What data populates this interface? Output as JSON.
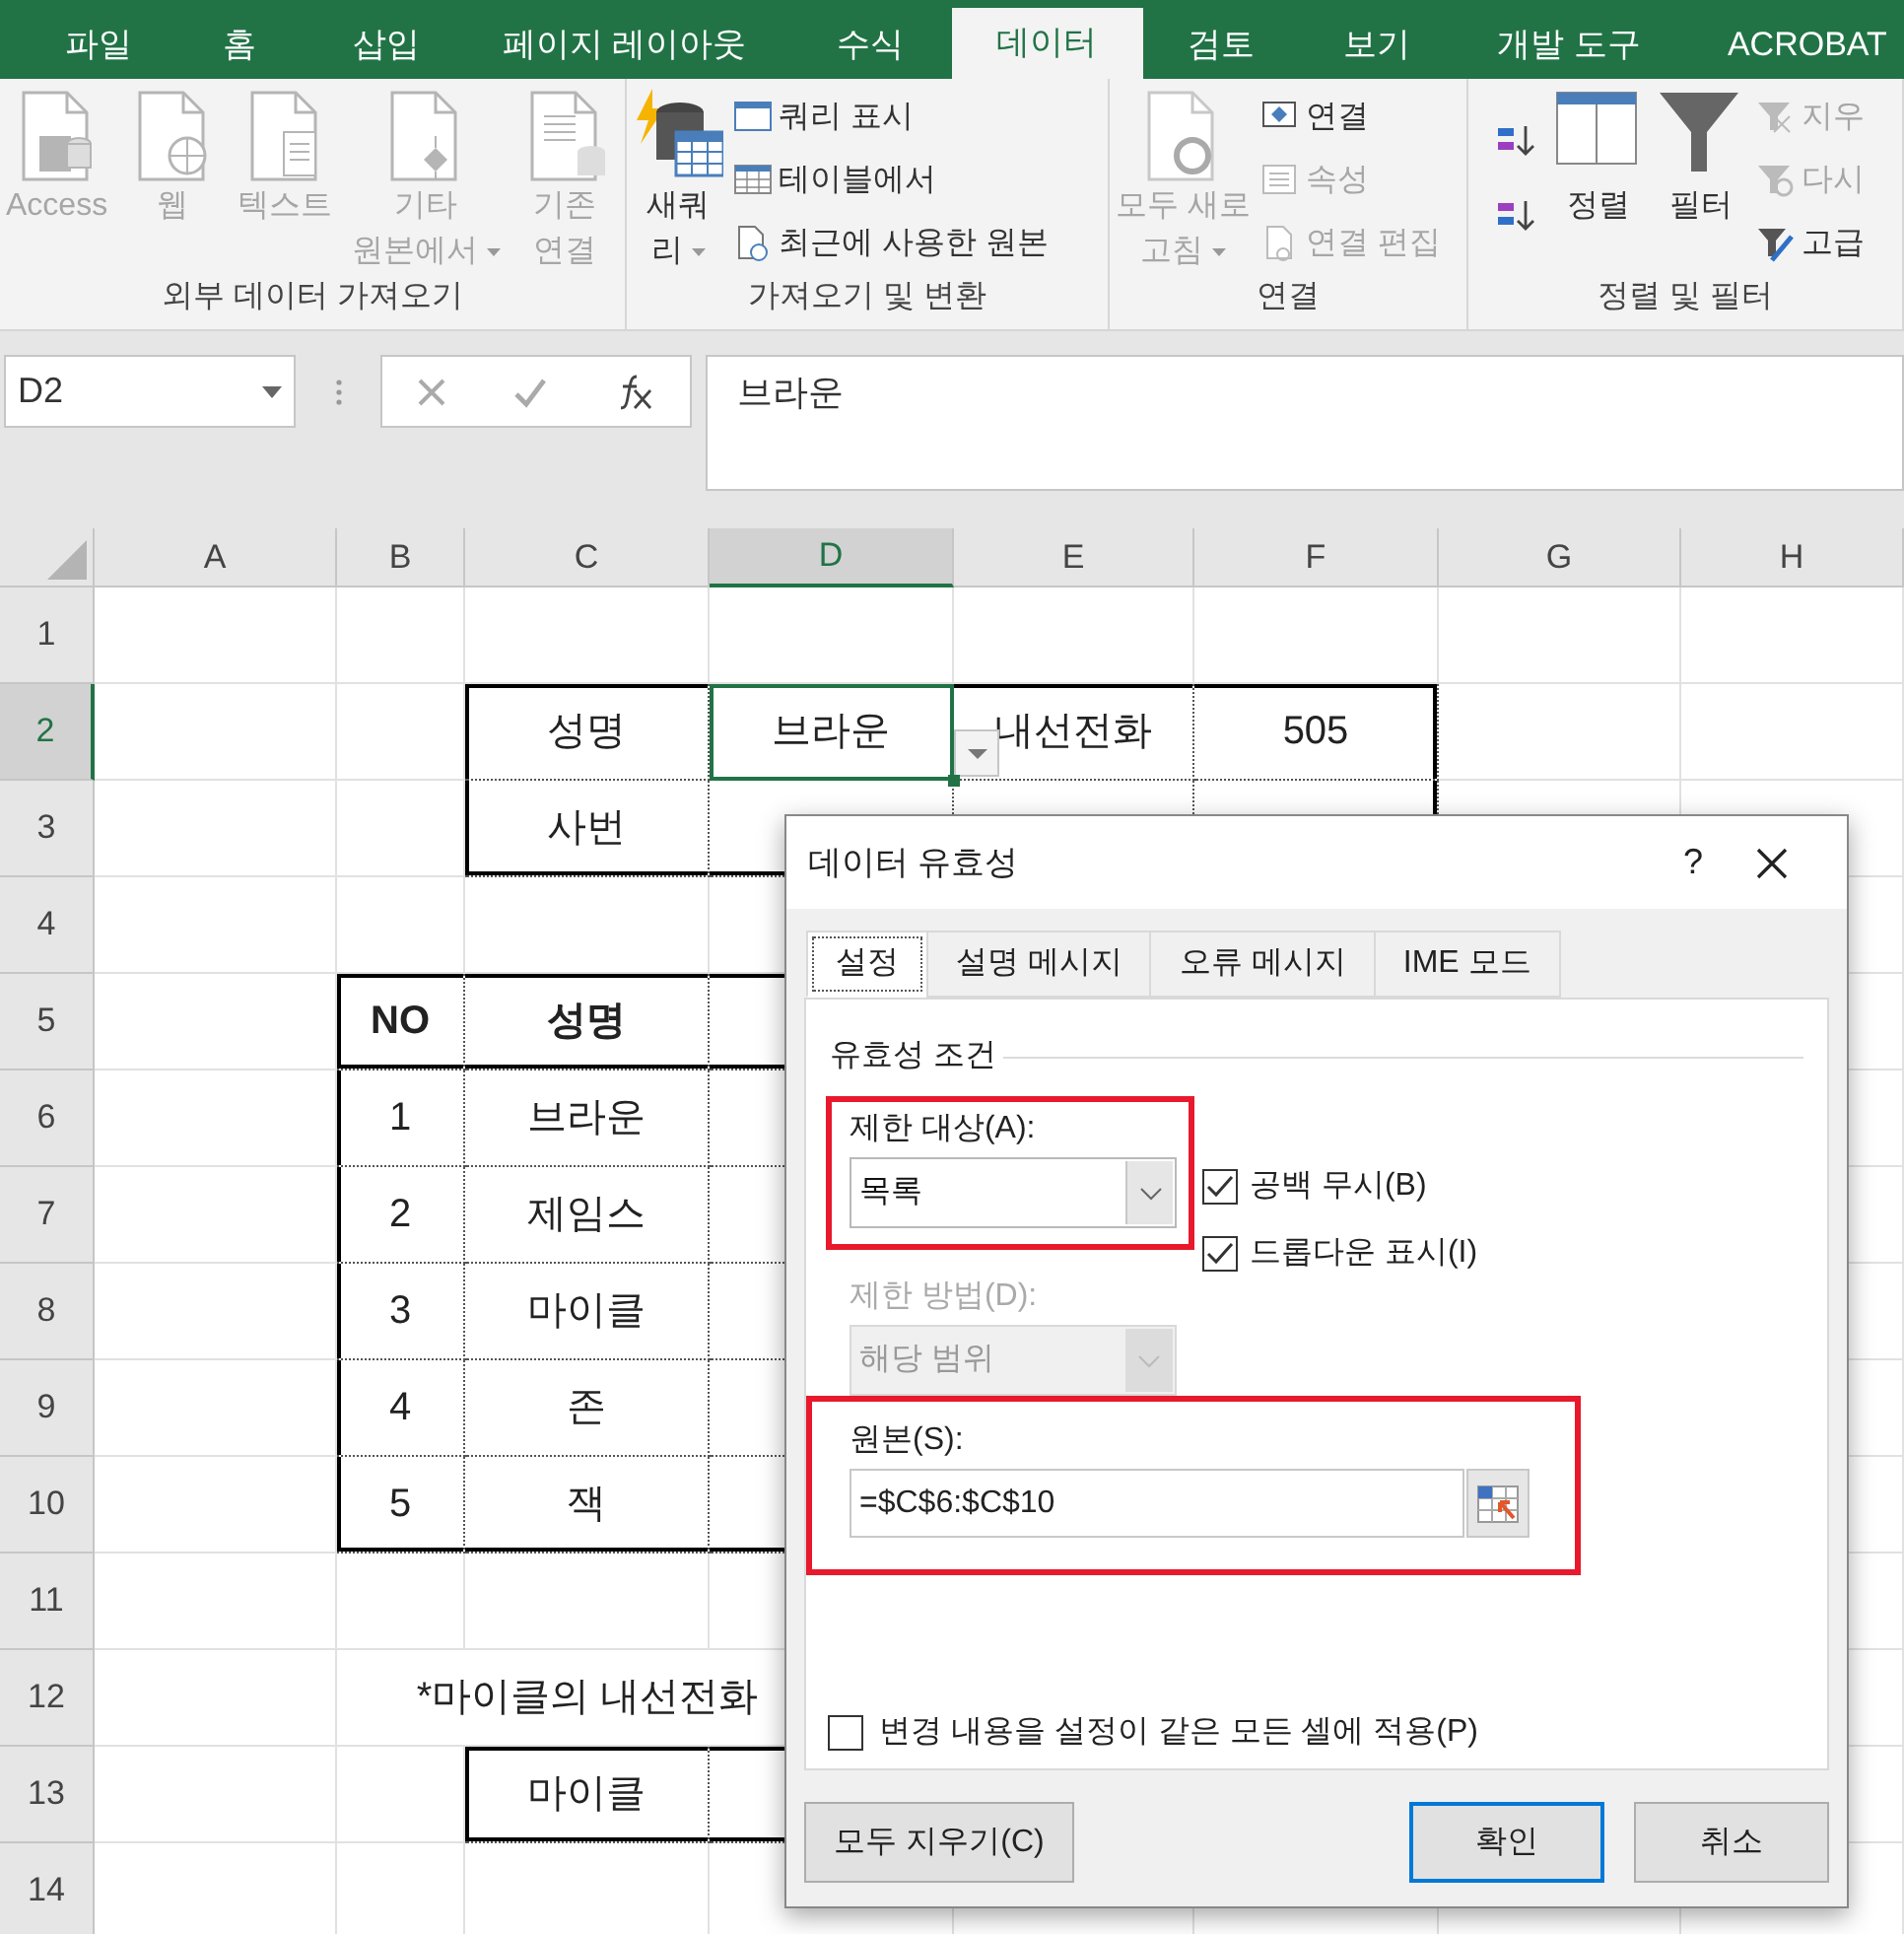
{
  "ribbon_tabs": [
    {
      "label": "파일",
      "selected": false
    },
    {
      "label": "홈",
      "selected": false
    },
    {
      "label": "삽입",
      "selected": false
    },
    {
      "label": "페이지 레이아웃",
      "selected": false
    },
    {
      "label": "수식",
      "selected": false
    },
    {
      "label": "데이터",
      "selected": true
    },
    {
      "label": "검토",
      "selected": false
    },
    {
      "label": "보기",
      "selected": false
    },
    {
      "label": "개발 도구",
      "selected": false
    },
    {
      "label": "ACROBAT",
      "selected": false
    }
  ],
  "ribbon_groups": [
    {
      "label": "외부 데이터 가져오기",
      "buttons": [
        {
          "kind": "large",
          "lines": [
            "Access"
          ],
          "disabled": true
        },
        {
          "kind": "large",
          "lines": [
            "웹"
          ],
          "disabled": true
        },
        {
          "kind": "large",
          "lines": [
            "텍스트"
          ],
          "disabled": true
        },
        {
          "kind": "large",
          "lines": [
            "기타",
            "원본에서"
          ],
          "menu": true,
          "disabled": true
        },
        {
          "kind": "large",
          "lines": [
            "기존",
            "연결"
          ],
          "disabled": true
        }
      ]
    },
    {
      "label": "가져오기 및 변환",
      "buttons": [
        {
          "kind": "large",
          "lines": [
            "새쿼",
            "리"
          ],
          "menu": true,
          "disabled": false
        },
        {
          "kind": "small",
          "lines": [
            "쿼리 표시"
          ],
          "disabled": false
        },
        {
          "kind": "small",
          "lines": [
            "테이블에서"
          ],
          "disabled": false
        },
        {
          "kind": "small",
          "lines": [
            "최근에 사용한 원본"
          ],
          "disabled": false
        }
      ]
    },
    {
      "label": "연결",
      "buttons": [
        {
          "kind": "large",
          "lines": [
            "모두 새로",
            "고침"
          ],
          "menu": true,
          "disabled": true
        },
        {
          "kind": "small",
          "lines": [
            "연결"
          ],
          "disabled": false
        },
        {
          "kind": "small",
          "lines": [
            "속성"
          ],
          "disabled": true
        },
        {
          "kind": "small",
          "lines": [
            "연결 편집"
          ],
          "disabled": true
        }
      ]
    },
    {
      "label": "정렬 및 필터",
      "buttons": [
        {
          "kind": "icon",
          "disabled": false
        },
        {
          "kind": "icon",
          "disabled": false
        },
        {
          "kind": "large",
          "lines": [
            "정렬"
          ],
          "disabled": false
        },
        {
          "kind": "large",
          "lines": [
            "필터"
          ],
          "disabled": false
        },
        {
          "kind": "small",
          "lines": [
            "지우"
          ],
          "disabled": true
        },
        {
          "kind": "small",
          "lines": [
            "다시"
          ],
          "disabled": true
        },
        {
          "kind": "small",
          "lines": [
            "고급"
          ],
          "disabled": false
        }
      ]
    }
  ],
  "name_box": "D2",
  "formula": "브라운",
  "columns": [
    {
      "label": "A",
      "selected": false
    },
    {
      "label": "B",
      "selected": false
    },
    {
      "label": "C",
      "selected": false
    },
    {
      "label": "D",
      "selected": true
    },
    {
      "label": "E",
      "selected": false
    },
    {
      "label": "F",
      "selected": false
    },
    {
      "label": "G",
      "selected": false
    },
    {
      "label": "H",
      "selected": false
    }
  ],
  "rows": [
    {
      "header": "1",
      "selected": false,
      "cells": {}
    },
    {
      "header": "2",
      "selected": true,
      "cells": {
        "C": {
          "text": "성명",
          "selected": false
        },
        "D": {
          "text": "브라운",
          "selected": true
        },
        "E": {
          "text": "내선전화",
          "selected": false
        },
        "F": {
          "text": "505",
          "selected": false
        }
      }
    },
    {
      "header": "3",
      "selected": false,
      "cells": {
        "C": {
          "text": "사번",
          "selected": false
        }
      }
    },
    {
      "header": "4",
      "selected": false,
      "cells": {}
    },
    {
      "header": "5",
      "selected": false,
      "cells": {
        "B": {
          "text": "NO",
          "bold": true,
          "selected": false
        },
        "C": {
          "text": "성명",
          "bold": true,
          "selected": false
        }
      }
    },
    {
      "header": "6",
      "selected": false,
      "cells": {
        "B": {
          "text": "1",
          "selected": false
        },
        "C": {
          "text": "브라운",
          "selected": false
        }
      }
    },
    {
      "header": "7",
      "selected": false,
      "cells": {
        "B": {
          "text": "2",
          "selected": false
        },
        "C": {
          "text": "제임스",
          "selected": false
        }
      }
    },
    {
      "header": "8",
      "selected": false,
      "cells": {
        "B": {
          "text": "3",
          "selected": false
        },
        "C": {
          "text": "마이클",
          "selected": false
        }
      }
    },
    {
      "header": "9",
      "selected": false,
      "cells": {
        "B": {
          "text": "4",
          "selected": false
        },
        "C": {
          "text": "존",
          "selected": false
        }
      }
    },
    {
      "header": "10",
      "selected": false,
      "cells": {
        "B": {
          "text": "5",
          "selected": false
        },
        "C": {
          "text": "잭",
          "selected": false
        }
      }
    },
    {
      "header": "11",
      "selected": false,
      "cells": {}
    },
    {
      "header": "12",
      "selected": false,
      "cells": {
        "C": {
          "text": "*마이클의 내선전화",
          "selected": false
        }
      }
    },
    {
      "header": "13",
      "selected": false,
      "cells": {
        "C": {
          "text": "마이클",
          "selected": false
        }
      }
    },
    {
      "header": "14",
      "selected": false,
      "cells": {}
    }
  ],
  "dialog": {
    "title": "데이터 유효성",
    "help": "?",
    "tabs": [
      {
        "label": "설정",
        "selected": true
      },
      {
        "label": "설명 메시지",
        "selected": false
      },
      {
        "label": "오류 메시지",
        "selected": false
      },
      {
        "label": "IME 모드",
        "selected": false
      }
    ],
    "section_title": "유효성 조건",
    "allow": {
      "label": "제한 대상(A):",
      "value": "목록",
      "highlighted": true
    },
    "checkboxes": [
      {
        "label": "공백 무시(B)",
        "checked": true
      },
      {
        "label": "드롭다운 표시(I)",
        "checked": true
      }
    ],
    "data": {
      "label": "제한 방법(D):",
      "value": "해당 범위",
      "disabled": true
    },
    "source": {
      "label": "원본(S):",
      "value": "=$C$6:$C$10",
      "highlighted": true
    },
    "apply_all": {
      "label": "변경 내용을 설정이 같은 모든 셀에 적용(P)",
      "checked": false
    },
    "buttons": [
      {
        "label": "모두 지우기(C)",
        "default": false
      },
      {
        "label": "확인",
        "default": true
      },
      {
        "label": "취소",
        "default": false
      }
    ]
  }
}
